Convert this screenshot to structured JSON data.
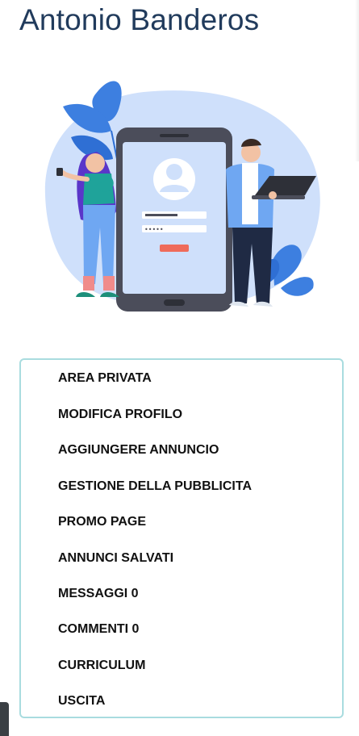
{
  "profile": {
    "name": "Antonio Banderos"
  },
  "illustration": {
    "icon": "login-illustration",
    "colors": {
      "blob": "#cfe0fb",
      "leaf": "#3d7fe0",
      "phone": "#4b4d5a",
      "button": "#ef6b5a"
    }
  },
  "menu": {
    "items": [
      {
        "label": "AREA PRIVATA"
      },
      {
        "label": "MODIFICA PROFILO"
      },
      {
        "label": "AGGIUNGERE ANNUNCIO"
      },
      {
        "label": "GESTIONE DELLA PUBBLICITA"
      },
      {
        "label": "PROMO PAGE"
      },
      {
        "label": "ANNUNCI SALVATI"
      },
      {
        "label": "MESSAGGI 0"
      },
      {
        "label": "COMMENTI 0"
      },
      {
        "label": "CURRICULUM"
      },
      {
        "label": "USCITA"
      }
    ]
  }
}
